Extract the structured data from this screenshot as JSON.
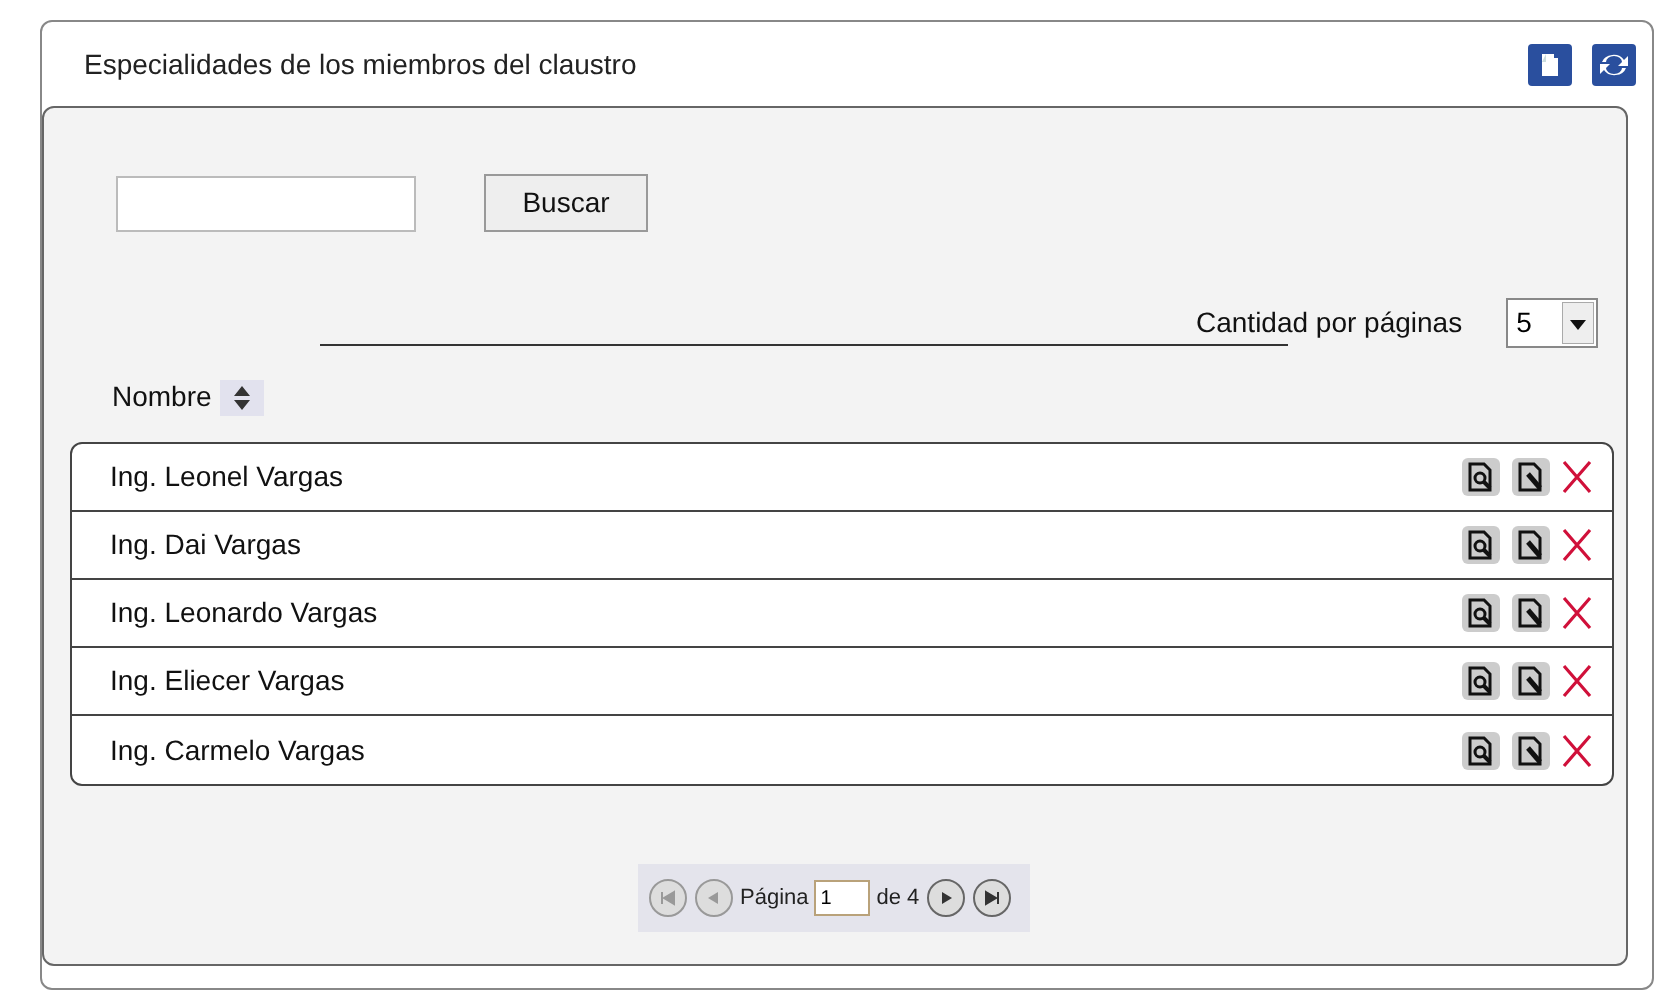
{
  "title": "Especialidades de los miembros del claustro",
  "search_button": "Buscar",
  "page_size": {
    "label": "Cantidad por páginas",
    "value": "5"
  },
  "column": "Nombre",
  "rows": [
    {
      "name": "Ing. Leonel Vargas"
    },
    {
      "name": "Ing. Dai Vargas"
    },
    {
      "name": "Ing. Leonardo Vargas"
    },
    {
      "name": "Ing. Eliecer Vargas"
    },
    {
      "name": "Ing. Carmelo Vargas"
    }
  ],
  "pager": {
    "label": "Página",
    "page": "1",
    "total": "de 4"
  }
}
